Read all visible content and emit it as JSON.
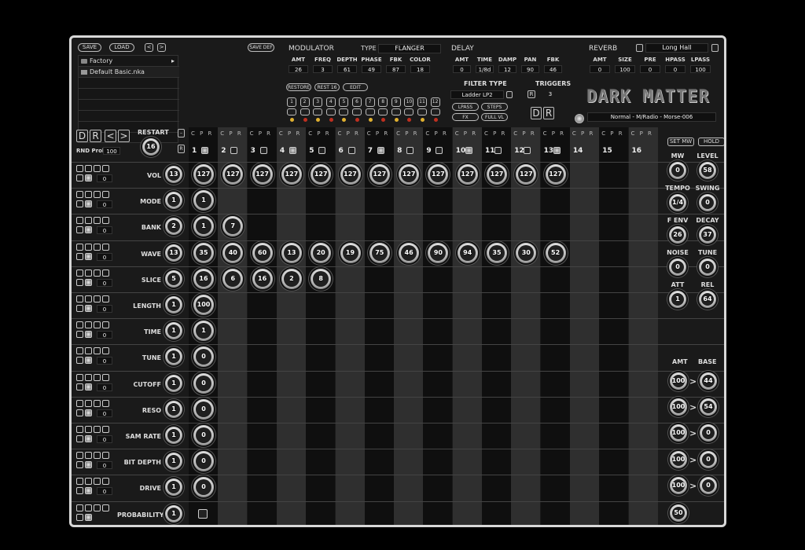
{
  "toolbar": {
    "save": "SAVE",
    "load": "LOAD",
    "prev": "<",
    "next": ">",
    "save_def": "SAVE DEF"
  },
  "browser": {
    "items": [
      "Factory",
      "Default Basic.nka"
    ]
  },
  "modulator": {
    "title": "MODULATOR",
    "type_label": "TYPE",
    "type_value": "FLANGER",
    "params": [
      {
        "label": "AMT",
        "value": "26"
      },
      {
        "label": "FREQ",
        "value": "3"
      },
      {
        "label": "DEPTH",
        "value": "61"
      },
      {
        "label": "PHASE",
        "value": "49"
      },
      {
        "label": "FBK",
        "value": "87"
      },
      {
        "label": "COLOR",
        "value": "18"
      }
    ]
  },
  "delay": {
    "title": "DELAY",
    "params": [
      {
        "label": "AMT",
        "value": "0"
      },
      {
        "label": "TIME",
        "value": "1/8d"
      },
      {
        "label": "DAMP",
        "value": "12"
      },
      {
        "label": "PAN",
        "value": "90"
      },
      {
        "label": "FBK",
        "value": "46"
      }
    ]
  },
  "reverb": {
    "title": "REVERB",
    "preset": "Long Hall",
    "params": [
      {
        "label": "AMT",
        "value": "0"
      },
      {
        "label": "SIZE",
        "value": "100"
      },
      {
        "label": "PRE",
        "value": "0"
      },
      {
        "label": "HPASS",
        "value": "0"
      },
      {
        "label": "LPASS",
        "value": "100"
      }
    ]
  },
  "buttons": {
    "restore": "RESTORE",
    "rest16": "REST 16",
    "edit": "EDIT"
  },
  "track_numbers": [
    "1",
    "2",
    "3",
    "4",
    "5",
    "6",
    "7",
    "8",
    "9",
    "10",
    "11",
    "12"
  ],
  "filter": {
    "title": "FILTER TYPE",
    "value": "Ladder LP2",
    "lpass": "LPASS",
    "steps": "STEPS",
    "fx": "FX",
    "fullvl": "FULL VL"
  },
  "triggers": {
    "title": "TRIGGERS",
    "r": "R",
    "value": "3",
    "d": "D",
    "r2": "R"
  },
  "logo": "DARK MATTER",
  "preset_display": "Normal - M/Radio - Morse-006",
  "sequencer": {
    "d": "D",
    "r": "R",
    "lt": "<",
    "gt": ">",
    "restart": "RESTART",
    "restart_value": "16",
    "rnd_prob": "RND Prob",
    "rnd_prob_value": "100",
    "cpr": "C P R",
    "step_numbers": [
      "1",
      "2",
      "3",
      "4",
      "5",
      "6",
      "7",
      "8",
      "9",
      "10",
      "11",
      "12",
      "13",
      "14",
      "15",
      "16"
    ],
    "rows": [
      {
        "label": "VOL",
        "count": "13",
        "zero": "0",
        "steps": [
          "127",
          "127",
          "127",
          "127",
          "127",
          "127",
          "127",
          "127",
          "127",
          "127",
          "127",
          "127",
          "127"
        ]
      },
      {
        "label": "MODE",
        "count": "1",
        "zero": "0",
        "steps": [
          "1"
        ]
      },
      {
        "label": "BANK",
        "count": "2",
        "zero": "0",
        "steps": [
          "1",
          "7"
        ]
      },
      {
        "label": "WAVE",
        "count": "13",
        "zero": "0",
        "steps": [
          "35",
          "40",
          "60",
          "13",
          "20",
          "19",
          "75",
          "46",
          "90",
          "94",
          "35",
          "30",
          "52"
        ]
      },
      {
        "label": "SLICE",
        "count": "5",
        "zero": "0",
        "steps": [
          "16",
          "6",
          "16",
          "2",
          "8"
        ]
      },
      {
        "label": "LENGTH",
        "count": "1",
        "zero": "0",
        "steps": [
          "100"
        ]
      },
      {
        "label": "TIME",
        "count": "1",
        "zero": "0",
        "steps": [
          "1"
        ]
      },
      {
        "label": "TUNE",
        "count": "1",
        "zero": "0",
        "steps": [
          "0"
        ]
      },
      {
        "label": "CUTOFF",
        "count": "1",
        "zero": "0",
        "steps": [
          "0"
        ]
      },
      {
        "label": "RESO",
        "count": "1",
        "zero": "0",
        "steps": [
          "0"
        ]
      },
      {
        "label": "SAM RATE",
        "count": "1",
        "zero": "0",
        "steps": [
          "0"
        ]
      },
      {
        "label": "BIT DEPTH",
        "count": "1",
        "zero": "0",
        "steps": [
          "0"
        ]
      },
      {
        "label": "DRIVE",
        "count": "1",
        "zero": "0",
        "steps": [
          "0"
        ]
      },
      {
        "label": "PROBABILITY",
        "count": "1",
        "zero": "",
        "steps": []
      }
    ]
  },
  "right_panel": {
    "set_mw": "SET MW",
    "hold": "HOLD",
    "knobs": [
      {
        "label": "MW",
        "value": "0"
      },
      {
        "label": "LEVEL",
        "value": "58"
      },
      {
        "label": "TEMPO",
        "value": "1/4"
      },
      {
        "label": "SWING",
        "value": "0"
      },
      {
        "label": "F ENV",
        "value": "26"
      },
      {
        "label": "DECAY",
        "value": "37"
      },
      {
        "label": "NOISE",
        "value": "0"
      },
      {
        "label": "TUNE",
        "value": "0"
      },
      {
        "label": "ATT",
        "value": "1"
      },
      {
        "label": "REL",
        "value": "64"
      }
    ],
    "amt_label": "AMT",
    "base_label": "BASE",
    "arrow": ">",
    "amt_base": [
      {
        "amt": "100",
        "base": "44"
      },
      {
        "amt": "100",
        "base": "54"
      },
      {
        "amt": "100",
        "base": "0"
      },
      {
        "amt": "100",
        "base": "0"
      },
      {
        "amt": "100",
        "base": "0"
      }
    ],
    "prob": "50"
  }
}
